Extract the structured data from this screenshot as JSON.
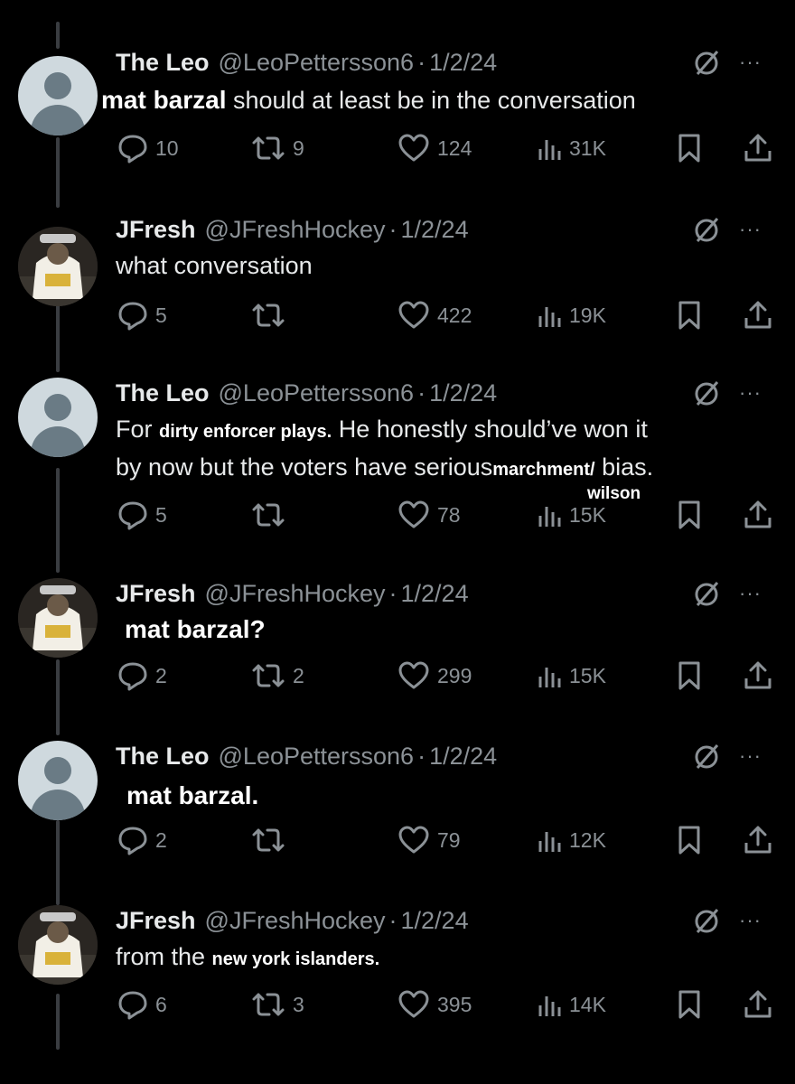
{
  "tweets": [
    {
      "name": "The Leo",
      "handle": "@LeoPettersson6",
      "date": "1/2/24",
      "avatar": "default-avatar",
      "text_overlay": "mat barzal",
      "text": " should at least be in the conversation",
      "replies": "10",
      "retweets": "9",
      "likes": "124",
      "views": "31K"
    },
    {
      "name": "JFresh",
      "handle": "@JFreshHockey",
      "date": "1/2/24",
      "avatar": "hockey-photo-avatar",
      "text": "what conversation",
      "replies": "5",
      "retweets": "",
      "likes": "422",
      "views": "19K"
    },
    {
      "name": "The Leo",
      "handle": "@LeoPettersson6",
      "date": "1/2/24",
      "avatar": "default-avatar",
      "line1_prefix": "For ",
      "line1_overlay": "dirty enforcer plays.",
      "line1_suffix": " He honestly should’ve won it",
      "line2_prefix": "by now but the voters have serious",
      "line2_overlay": "marchment/",
      "line2_suffix": " bias.",
      "overlay_extra": "wilson",
      "replies": "5",
      "retweets": "",
      "likes": "78",
      "views": "15K"
    },
    {
      "name": "JFresh",
      "handle": "@JFreshHockey",
      "date": "1/2/24",
      "avatar": "hockey-photo-avatar",
      "text_overlay": "mat barzal?",
      "replies": "2",
      "retweets": "2",
      "likes": "299",
      "views": "15K"
    },
    {
      "name": "The Leo",
      "handle": "@LeoPettersson6",
      "date": "1/2/24",
      "avatar": "default-avatar",
      "text_overlay": "mat barzal.",
      "replies": "2",
      "retweets": "",
      "likes": "79",
      "views": "12K"
    },
    {
      "name": "JFresh",
      "handle": "@JFreshHockey",
      "date": "1/2/24",
      "avatar": "hockey-photo-avatar",
      "text_prefix": "from the ",
      "text_overlay": "new york islanders.",
      "replies": "6",
      "retweets": "3",
      "likes": "395",
      "views": "14K"
    }
  ],
  "dot": "·",
  "more": "···",
  "colors": {
    "background": "#000000",
    "text": "#e7e9ea",
    "muted": "#8b9196",
    "thread_line": "#3a3d41"
  }
}
